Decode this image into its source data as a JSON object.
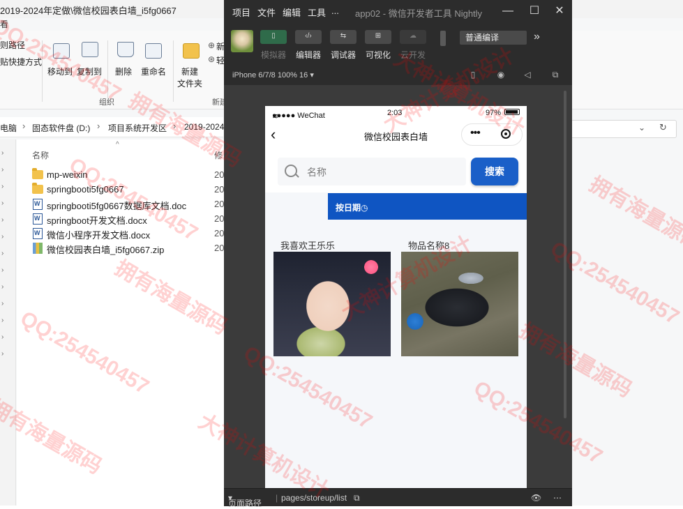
{
  "explorer": {
    "window_title": "2019-2024年定做\\微信校园表白墙_i5fg0667",
    "menu_fragment": "看",
    "ribbon": {
      "left_items": [
        "则路径",
        "贴快捷方式"
      ],
      "move_to": "移动到",
      "copy_to": "复制到",
      "delete": "删除",
      "rename": "重命名",
      "new_folder_line1": "新建",
      "new_folder_line2": "文件夹",
      "group_organize": "组织",
      "group_new": "新建",
      "new_item_fragment": "新",
      "easy_access_fragment": "轻"
    },
    "breadcrumb": [
      "电脑",
      "固态软件盘 (D:)",
      "项目系统开发区",
      "2019-2024"
    ],
    "columns": {
      "name": "名称",
      "modified": "修"
    },
    "files": [
      {
        "name": "mp-weixin",
        "type": "folder",
        "date": "20"
      },
      {
        "name": "springbooti5fg0667",
        "type": "folder",
        "date": "20"
      },
      {
        "name": "springbooti5fg0667数据库文档.doc",
        "type": "doc",
        "date": "20"
      },
      {
        "name": "springboot开发文档.docx",
        "type": "doc",
        "date": "20"
      },
      {
        "name": "微信小程序开发文档.docx",
        "type": "doc",
        "date": "20"
      },
      {
        "name": "微信校园表白墙_i5fg0667.zip",
        "type": "zip",
        "date": "20"
      }
    ]
  },
  "devtools": {
    "menu": [
      "项目",
      "文件",
      "编辑",
      "工具",
      "..."
    ],
    "app_title": "app02 - 微信开发者工具 Nightly",
    "tools": [
      {
        "label": "模拟器",
        "active": false,
        "dim": true
      },
      {
        "label": "编辑器",
        "active": true
      },
      {
        "label": "调试器",
        "active": true
      },
      {
        "label": "可视化",
        "active": true
      },
      {
        "label": "云开发",
        "active": false,
        "dim": true
      }
    ],
    "compile_mode": "普通编译",
    "device": "iPhone 6/7/8 100% 16",
    "status_page_path_label": "页面路径",
    "status_page_path": "pages/storeup/list"
  },
  "phone": {
    "carrier": "●●●●● WeChat",
    "time": "2:03",
    "battery": "97%",
    "nav_title": "微信校园表白墙",
    "search_placeholder": "名称",
    "search_button": "搜索",
    "filter_label": "按日期",
    "cards": [
      {
        "title": "我喜欢王乐乐",
        "image": "girl-photo"
      },
      {
        "title": "物品名称8",
        "image": "car-keys-photo"
      }
    ]
  },
  "watermarks": [
    "QQ:254540457",
    "拥有海量源码",
    "大神计算机设计"
  ]
}
